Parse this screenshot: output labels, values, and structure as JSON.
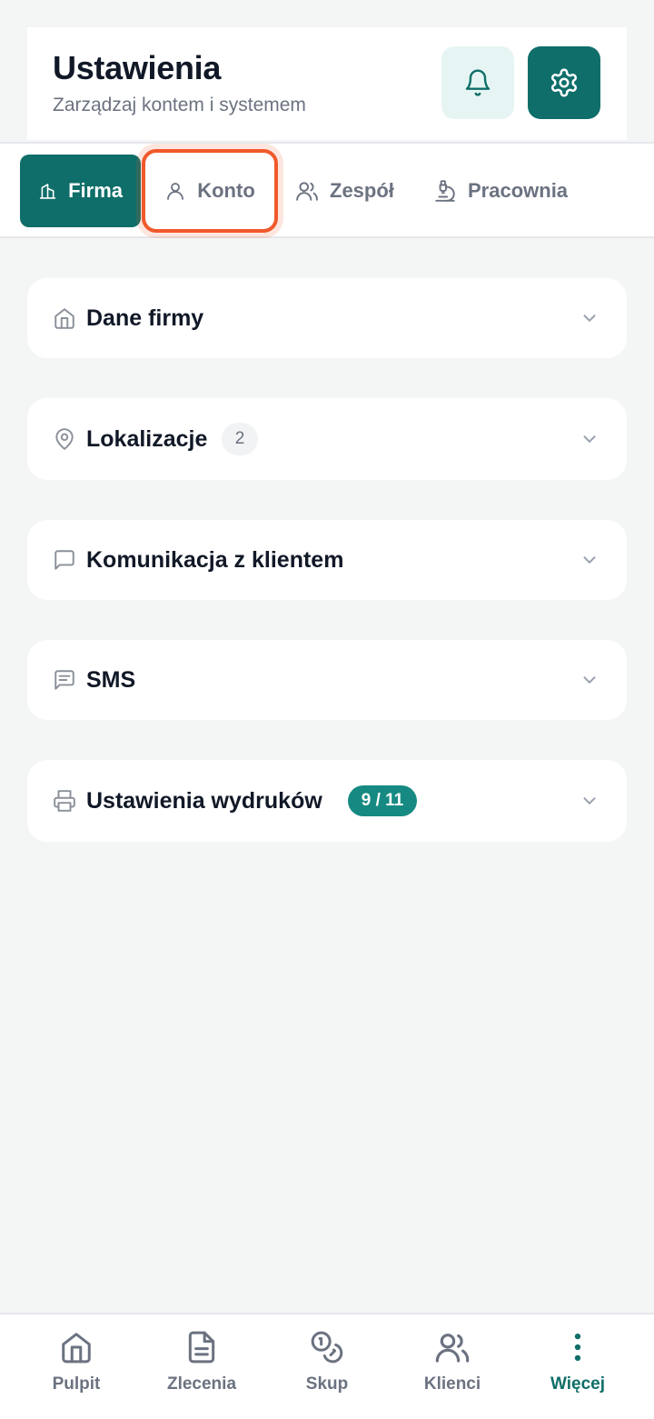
{
  "header": {
    "title": "Ustawienia",
    "subtitle": "Zarządzaj kontem i systemem",
    "bell_icon": "bell-icon",
    "gear_icon": "gear-icon"
  },
  "tabs": [
    {
      "label": "Firma",
      "icon": "building-icon",
      "active": true
    },
    {
      "label": "Konto",
      "icon": "user-icon",
      "highlighted": true
    },
    {
      "label": "Zespół",
      "icon": "users-icon"
    },
    {
      "label": "Pracownia",
      "icon": "microscope-icon"
    }
  ],
  "sections": [
    {
      "title": "Dane firmy",
      "icon": "home-icon"
    },
    {
      "title": "Lokalizacje",
      "icon": "map-pin-icon",
      "count": "2"
    },
    {
      "title": "Komunikacja z klientem",
      "icon": "message-icon"
    },
    {
      "title": "SMS",
      "icon": "message-lines-icon"
    },
    {
      "title": "Ustawienia wydruków",
      "icon": "printer-icon",
      "badge": "9 / 11"
    }
  ],
  "bottom_nav": [
    {
      "label": "Pulpit",
      "icon": "home-icon"
    },
    {
      "label": "Zlecenia",
      "icon": "document-icon"
    },
    {
      "label": "Skup",
      "icon": "coins-icon"
    },
    {
      "label": "Klienci",
      "icon": "users-icon"
    },
    {
      "label": "Więcej",
      "icon": "more-vertical-icon",
      "active": true
    }
  ],
  "colors": {
    "brand": "#0f6e69",
    "highlight": "#f0592b",
    "background": "#f4f6f5",
    "muted_text": "#6b7280"
  }
}
